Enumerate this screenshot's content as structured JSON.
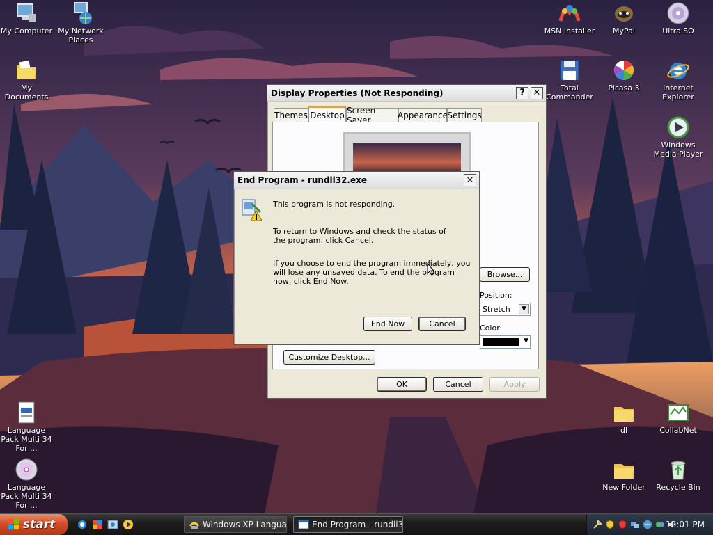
{
  "desktop": {
    "icons_left": [
      {
        "label": "My Computer",
        "icon": "my-computer-icon"
      },
      {
        "label": "My Network Places",
        "icon": "network-places-icon"
      },
      {
        "label": "My Documents",
        "icon": "my-documents-icon"
      },
      {
        "label": "Language Pack Multi 34 For ...",
        "icon": "setup-file-icon"
      },
      {
        "label": "Language Pack Multi 34 For ...",
        "icon": "cd-image-icon"
      }
    ],
    "icons_right": [
      {
        "label": "MSN Installer",
        "icon": "msn-icon"
      },
      {
        "label": "MyPal",
        "icon": "mypal-icon"
      },
      {
        "label": "UltraISO",
        "icon": "ultraiso-icon"
      },
      {
        "label": "Total Commander",
        "icon": "floppy-icon"
      },
      {
        "label": "Picasa 3",
        "icon": "picasa-icon"
      },
      {
        "label": "Internet Explorer",
        "icon": "ie-icon"
      },
      {
        "label": "Windows Media Player",
        "icon": "media-player-icon"
      },
      {
        "label": "dl",
        "icon": "folder-icon"
      },
      {
        "label": "CollabNet",
        "icon": "collabnet-icon"
      },
      {
        "label": "New Folder",
        "icon": "folder-icon"
      },
      {
        "label": "Recycle Bin",
        "icon": "recycle-bin-icon"
      }
    ]
  },
  "display_properties": {
    "title": "Display Properties (Not Responding)",
    "tabs": [
      "Themes",
      "Desktop",
      "Screen Saver",
      "Appearance",
      "Settings"
    ],
    "active_tab": "Desktop",
    "browse_label": "Browse...",
    "position_label": "Position:",
    "position_value": "Stretch",
    "color_label": "Color:",
    "customize_label": "Customize Desktop...",
    "ok_label": "OK",
    "cancel_label": "Cancel",
    "apply_label": "Apply",
    "help_glyph": "?",
    "close_glyph": "✕"
  },
  "end_program": {
    "title": "End Program - rundll32.exe",
    "line1": "This program is not responding.",
    "line2": "To return to Windows and check the status of the program, click Cancel.",
    "line3": "If you choose to end the program immediately, you will lose any unsaved data. To end the program now, click End Now.",
    "end_now_label": "End Now",
    "cancel_label": "Cancel",
    "close_glyph": "✕"
  },
  "taskbar": {
    "start_label": "start",
    "tasks": [
      {
        "label": "Windows XP Languag...",
        "active": false
      },
      {
        "label": "End Program - rundll3...",
        "active": true
      }
    ],
    "clock": "12:01 PM"
  },
  "colors": {
    "window_face": "#ece9d8",
    "start_button": "#d44d29",
    "tab_highlight": "#e6a12c"
  }
}
